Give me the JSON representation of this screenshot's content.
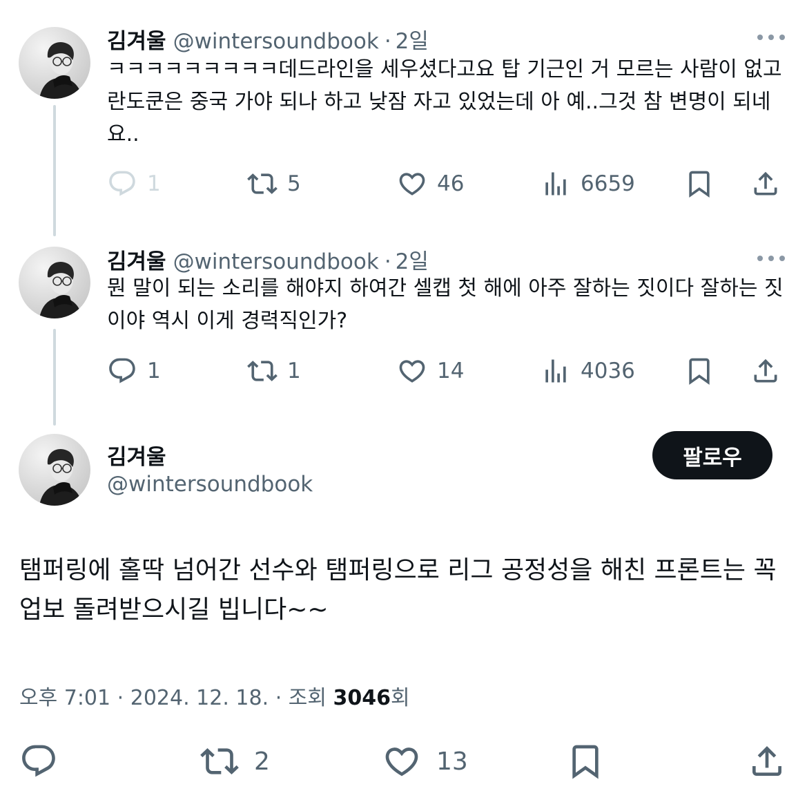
{
  "tweets": [
    {
      "name": "김겨울",
      "handle": "@wintersoundbook",
      "sep": "·",
      "age": "2일",
      "text": "ㅋㅋㅋㅋㅋㅋㅋㅋㅋ데드라인을 세우셨다고요 탑 기근인 거 모르는 사람이 없고 란도쿤은 중국 가야 되나 하고 낮잠 자고 있었는데 아 예..그것 참 변명이 되네요..",
      "replies": "1",
      "retweets": "5",
      "likes": "46",
      "views": "6659"
    },
    {
      "name": "김겨울",
      "handle": "@wintersoundbook",
      "sep": "·",
      "age": "2일",
      "text": "뭔 말이 되는 소리를 해야지 하여간 셀캡 첫 해에 아주 잘하는 짓이다 잘하는 짓이야 역시 이게 경력직인가?",
      "replies": "1",
      "retweets": "1",
      "likes": "14",
      "views": "4036"
    }
  ],
  "main": {
    "name": "김겨울",
    "handle": "@wintersoundbook",
    "follow_label": "팔로우",
    "text": "탬퍼링에 홀딱 넘어간 선수와 탬퍼링으로 리그 공정성을 해친 프론트는 꼭 업보 돌려받으시길 빕니다~~",
    "time": "오후 7:01",
    "sep": "·",
    "date": "2024. 12. 18.",
    "views_prefix": "· 조회",
    "views_count": "3046",
    "views_suffix": "회",
    "retweets": "2",
    "likes": "13"
  },
  "colors": {
    "text": "#0f1419",
    "secondary": "#536471",
    "faded": "#cfd9de",
    "button": "#0f1419"
  },
  "icons": [
    "more-icon",
    "reply-icon",
    "retweet-icon",
    "like-icon",
    "views-icon",
    "bookmark-icon",
    "share-icon"
  ]
}
